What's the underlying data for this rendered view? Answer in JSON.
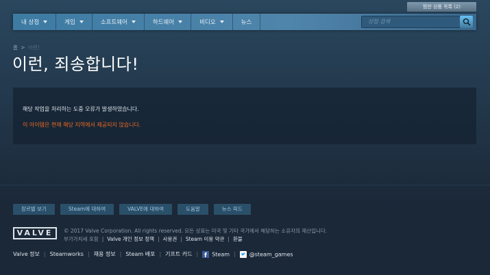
{
  "header": {
    "wishlist_label": "찜한 상품 목록 (2)",
    "nav_items": [
      {
        "label": "내 상점",
        "dropdown": true
      },
      {
        "label": "게임",
        "dropdown": true
      },
      {
        "label": "소프트웨어",
        "dropdown": true
      },
      {
        "label": "하드웨어",
        "dropdown": true
      },
      {
        "label": "비디오",
        "dropdown": true
      },
      {
        "label": "뉴스",
        "dropdown": false
      }
    ],
    "search_placeholder": "상점 검색",
    "search_icon": "search-icon"
  },
  "breadcrumb": {
    "home": "홈",
    "separator": ">",
    "current": "이런!"
  },
  "page_title": "이런, 죄송합니다!",
  "error": {
    "message": "해당 작업을 처리하는 도중 오류가 발생하였습니다.",
    "detail": "이 아이템은 현재 해당 지역에서 제공되지 않습니다.",
    "detail_color": "#f06a1f"
  },
  "footer": {
    "buttons": [
      "장르별 보기",
      "Steam에 대하여",
      "VALVE에 대하여",
      "도움말",
      "뉴스 피드"
    ],
    "logo_text": "VALVE",
    "copyright": "© 2017 Valve Corporation. All rights reserved. 모든 상표는 미국 및 기타 국가에서 해당하는 소유자의 재산입니다.",
    "vat_note": "부가가치세 포함",
    "legal_links": [
      "Valve 개인 정보 정책",
      "사용권",
      "Steam 이용 약관",
      "환불"
    ],
    "bottom_links": [
      "Valve 정보",
      "Steamworks",
      "채용 정보",
      "Steam 배포",
      "기프트 카드"
    ],
    "facebook_label": "Steam",
    "twitter_label": "@steam_games"
  },
  "colors": {
    "accent": "#67c1f5",
    "nav_bg": "#3e7ea7",
    "error_highlight": "#f06a1f"
  }
}
